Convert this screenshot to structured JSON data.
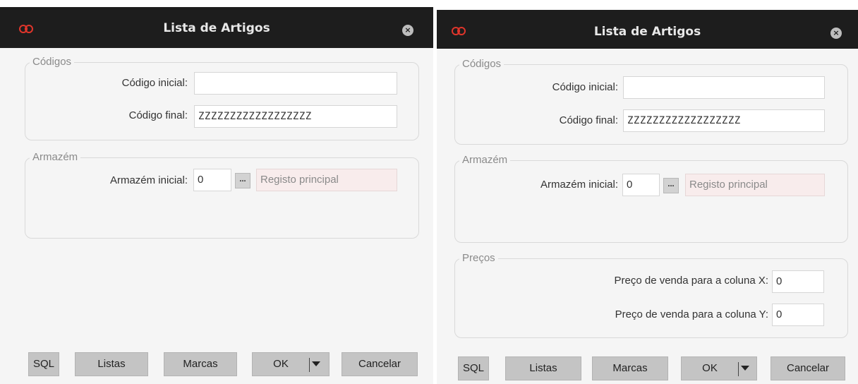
{
  "left_dialog": {
    "title": "Lista de Artigos",
    "close_symbol": "×",
    "codigos": {
      "legend": "Códigos",
      "codigo_inicial_label": "Código inicial:",
      "codigo_inicial_value": "",
      "codigo_final_label": "Código final:",
      "codigo_final_value": "ZZZZZZZZZZZZZZZZZZ"
    },
    "armazem": {
      "legend": "Armazém",
      "armazem_inicial_label": "Armazém inicial:",
      "armazem_inicial_value": "0",
      "lookup_label": "...",
      "armazem_desc": "Registo principal"
    },
    "buttons": {
      "sql": "SQL",
      "listas": "Listas",
      "marcas": "Marcas",
      "ok": "OK",
      "cancelar": "Cancelar"
    }
  },
  "right_dialog": {
    "title": "Lista de Artigos",
    "close_symbol": "×",
    "codigos": {
      "legend": "Códigos",
      "codigo_inicial_label": "Código inicial:",
      "codigo_inicial_value": "",
      "codigo_final_label": "Código final:",
      "codigo_final_value": "ZZZZZZZZZZZZZZZZZZ"
    },
    "armazem": {
      "legend": "Armazém",
      "armazem_inicial_label": "Armazém inicial:",
      "armazem_inicial_value": "0",
      "lookup_label": "...",
      "armazem_desc": "Registo principal"
    },
    "precos": {
      "legend": "Preços",
      "preco_x_label": "Preço de venda para a coluna X:",
      "preco_x_value": "0",
      "preco_y_label": "Preço de venda para a coluna Y:",
      "preco_y_value": "0"
    },
    "buttons": {
      "sql": "SQL",
      "listas": "Listas",
      "marcas": "Marcas",
      "ok": "OK",
      "cancelar": "Cancelar"
    }
  },
  "colors": {
    "titlebar": "#1d1d1d",
    "dialog_bg": "#f5f5f5",
    "button_bg": "#c4c4c4",
    "readonly_bg": "#f8ecec",
    "logo": "#e0352b"
  }
}
